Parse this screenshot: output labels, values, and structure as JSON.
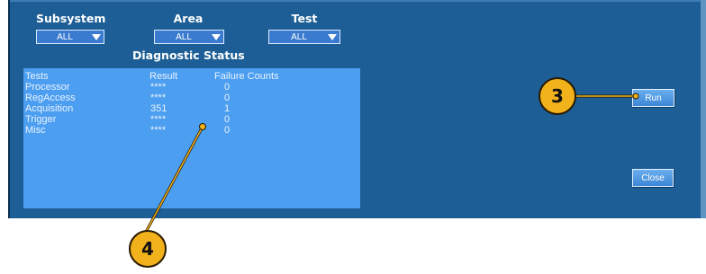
{
  "filters": {
    "subsystem": {
      "label": "Subsystem",
      "value": "ALL"
    },
    "area": {
      "label": "Area",
      "value": "ALL"
    },
    "test": {
      "label": "Test",
      "value": "ALL"
    }
  },
  "diagnostic_status": {
    "title": "Diagnostic Status",
    "columns": [
      "Tests",
      "Result",
      "Failure Counts"
    ],
    "rows": [
      {
        "test": "Processor",
        "result": "****",
        "failures": "0"
      },
      {
        "test": "RegAccess",
        "result": "****",
        "failures": "0"
      },
      {
        "test": "Acquisition",
        "result": "351",
        "failures": "1"
      },
      {
        "test": "Trigger",
        "result": "****",
        "failures": "0"
      },
      {
        "test": "Misc",
        "result": "****",
        "failures": "0"
      }
    ]
  },
  "buttons": {
    "run": "Run",
    "close": "Close"
  },
  "callouts": {
    "run_callout": "3",
    "results_callout": "4"
  },
  "colors": {
    "panel": "#1c5e95",
    "results_area": "#4c9ef0",
    "dropdown": "#3a7bcf",
    "callout": "#f2b21b"
  },
  "icons": {
    "dropdown_arrow": "chevron-down-icon"
  }
}
